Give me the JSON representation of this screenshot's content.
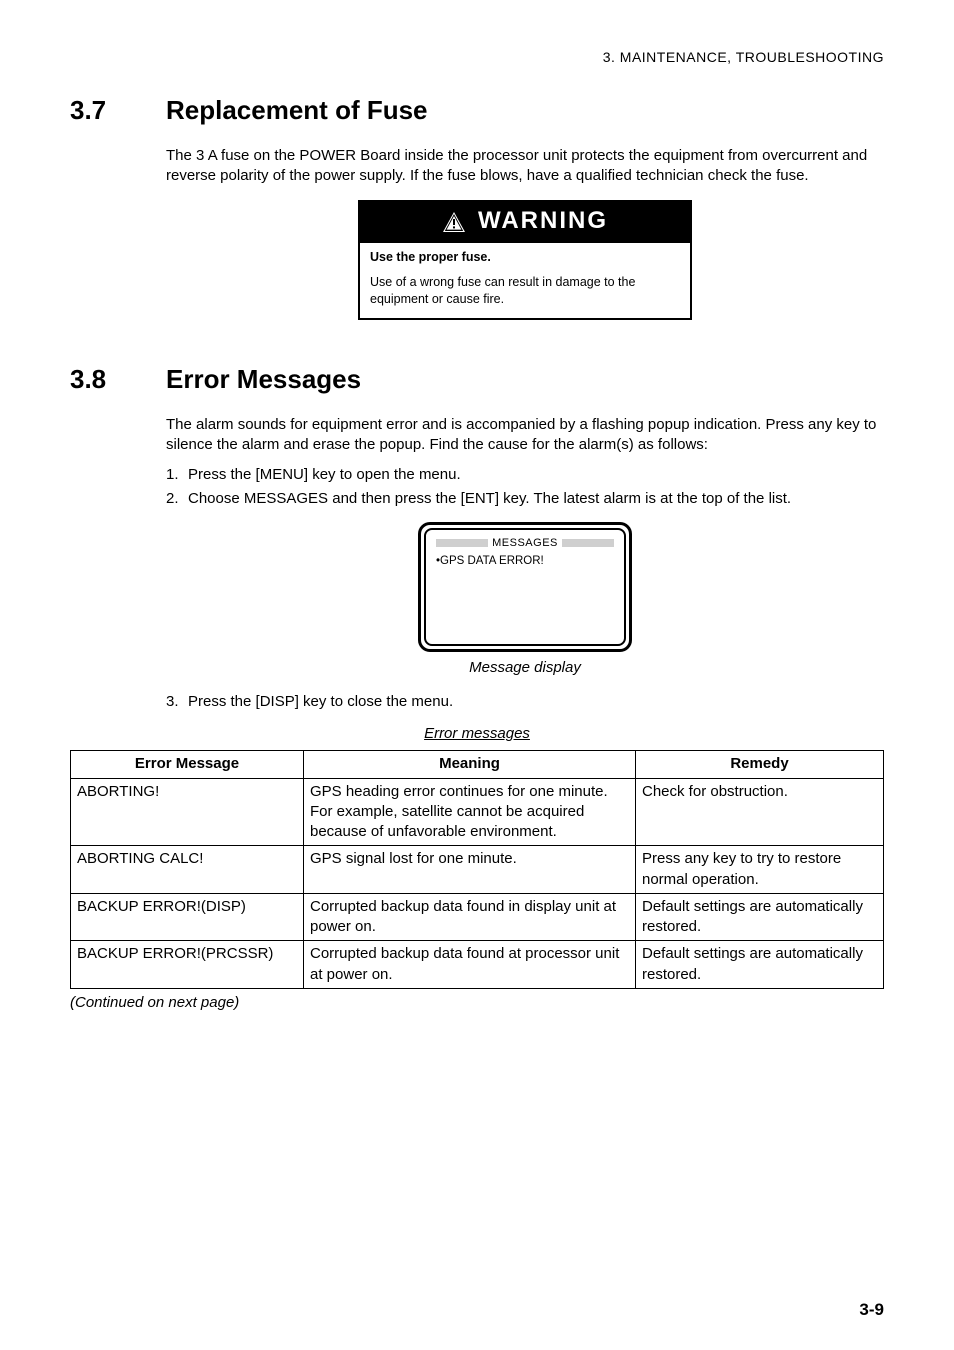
{
  "header": "3. MAINTENANCE, TROUBLESHOOTING",
  "section37": {
    "num": "3.7",
    "title": "Replacement of Fuse",
    "para": "The 3 A fuse on the POWER Board inside the processor unit protects the equipment from overcurrent and reverse polarity of the power supply. If the fuse blows, have a qualified technician check the fuse."
  },
  "warning": {
    "header": "WARNING",
    "bold": "Use the proper fuse.",
    "body": "Use of a wrong fuse can result in damage to the equipment or cause fire."
  },
  "section38": {
    "num": "3.8",
    "title": "Error Messages",
    "para": "The alarm sounds for equipment error and is accompanied by a flashing popup indication. Press any key to silence the alarm and erase the popup. Find the cause for the alarm(s) as follows:",
    "steps": [
      {
        "n": "1.",
        "t": "Press the [MENU] key to open the menu."
      },
      {
        "n": "2.",
        "t": "Choose MESSAGES and then press the [ENT] key. The latest alarm is at the top of the list."
      }
    ],
    "device": {
      "title": "MESSAGES",
      "line": "•GPS DATA ERROR!"
    },
    "device_caption": "Message display",
    "step3": {
      "n": "3.",
      "t": "Press the [DISP] key to close the menu."
    }
  },
  "table": {
    "caption": "Error messages",
    "headers": [
      "Error Message",
      "Meaning",
      "Remedy"
    ],
    "rows": [
      [
        "ABORTING!",
        "GPS heading error continues for one minute. For example, satellite cannot be acquired because of unfavorable environment.",
        "Check for obstruction."
      ],
      [
        "ABORTING CALC!",
        "GPS signal lost for one minute.",
        "Press any key to try to restore normal operation."
      ],
      [
        "BACKUP ERROR!(DISP)",
        "Corrupted backup data found in display unit at power on.",
        "Default settings are automatically restored."
      ],
      [
        "BACKUP ERROR!(PRCSSR)",
        "Corrupted backup data found at processor unit at power on.",
        "Default settings are automatically restored."
      ]
    ]
  },
  "continued": "(Continued on next page)",
  "footer_page": "3-9"
}
